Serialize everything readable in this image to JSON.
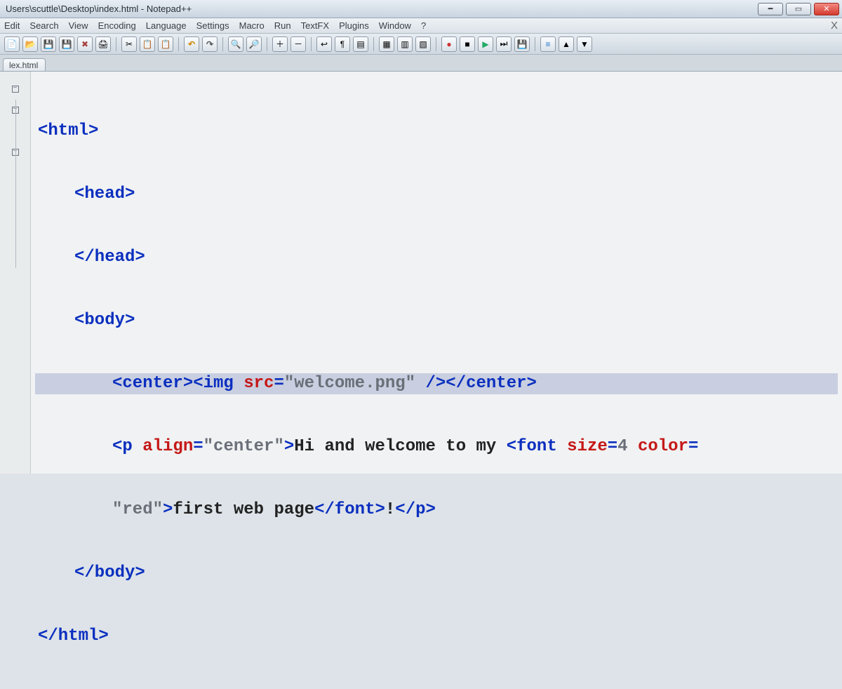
{
  "window": {
    "title": "Users\\scuttle\\Desktop\\index.html - Notepad++"
  },
  "menus": [
    "Edit",
    "Search",
    "View",
    "Encoding",
    "Language",
    "Settings",
    "Macro",
    "Run",
    "TextFX",
    "Plugins",
    "Window",
    "?"
  ],
  "tab_name": "lex.html",
  "code": {
    "l1": "<html>",
    "l2": "<head>",
    "l3": "</head>",
    "l4": "<body>",
    "l5a": "<center><img",
    "l5_attr": " src",
    "l5_eq": "=",
    "l5_str": "\"welcome.png\"",
    "l5b": " /></center>",
    "l6a": "<p",
    "l6_attr1": " align",
    "l6_eq1": "=",
    "l6_str1": "\"center\"",
    "l6b": ">",
    "l6_txt1": "Hi and welcome to my ",
    "l6c": "<font",
    "l6_attr2": " size",
    "l6_eq2": "=",
    "l6_str2": "4",
    "l6_attr3": " color",
    "l6_eq3": "=",
    "l7_str": "\"red\"",
    "l7a": ">",
    "l7_txt": "first web page",
    "l7b": "</font>",
    "l7_txt2": "!",
    "l7c": "</p>",
    "l8": "</body>",
    "l9": "</html>"
  }
}
